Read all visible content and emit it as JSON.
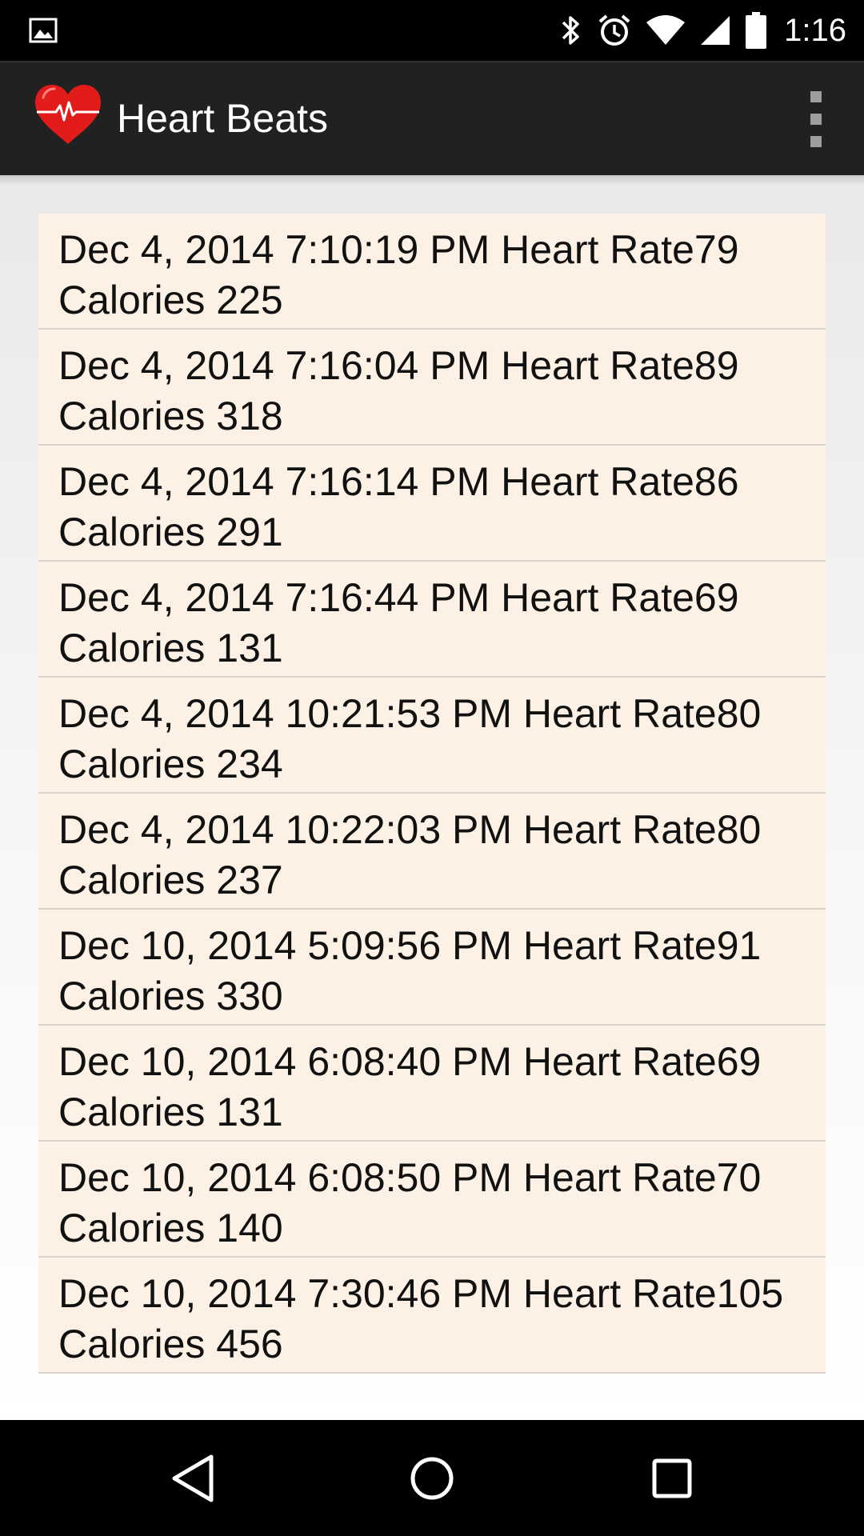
{
  "status_bar": {
    "time": "1:16",
    "icons": [
      "gallery-icon",
      "bluetooth-icon",
      "alarm-icon",
      "wifi-icon",
      "cell-signal-icon",
      "battery-icon"
    ]
  },
  "action_bar": {
    "title": "Heart Beats",
    "logo_icon": "heart-pulse-icon",
    "menu_icon": "overflow-menu-icon",
    "background": "#212121"
  },
  "records": [
    {
      "text": "Dec 4, 2014 7:10:19 PM Heart Rate79 Calories 225"
    },
    {
      "text": "Dec 4, 2014 7:16:04 PM Heart Rate89 Calories 318"
    },
    {
      "text": "Dec 4, 2014 7:16:14 PM Heart Rate86 Calories 291"
    },
    {
      "text": "Dec 4, 2014 7:16:44 PM Heart Rate69 Calories 131"
    },
    {
      "text": "Dec 4, 2014 10:21:53 PM Heart Rate80 Calories 234"
    },
    {
      "text": "Dec 4, 2014 10:22:03 PM Heart Rate80 Calories 237"
    },
    {
      "text": "Dec 10, 2014 5:09:56 PM Heart Rate91 Calories 330"
    },
    {
      "text": "Dec 10, 2014 6:08:40 PM Heart Rate69 Calories 131"
    },
    {
      "text": "Dec 10, 2014 6:08:50 PM Heart Rate70 Calories 140"
    },
    {
      "text": "Dec 10, 2014 7:30:46 PM Heart Rate105 Calories 456"
    }
  ],
  "list_style": {
    "item_background": "#fcf1e4",
    "divider": "#d9d2ca"
  },
  "nav_bar": {
    "icons": [
      "back-icon",
      "home-icon",
      "recents-icon"
    ]
  }
}
